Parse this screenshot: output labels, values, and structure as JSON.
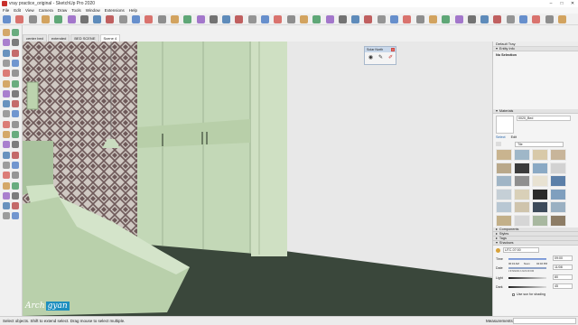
{
  "window": {
    "title": "vray practice_original - SketchUp Pro 2020",
    "controls": [
      "–",
      "□",
      "✕"
    ]
  },
  "menu": [
    "File",
    "Edit",
    "View",
    "Camera",
    "Draw",
    "Tools",
    "Window",
    "Extensions",
    "Help"
  ],
  "toolbar": {
    "icons": [
      "select-icon",
      "paint-icon",
      "eraser-icon",
      "line-icon",
      "move-icon",
      "rotate-icon",
      "pushpull-icon",
      "offset-icon",
      "tape-icon",
      "text-icon",
      "orbit-icon",
      "pan-icon",
      "zoom-icon",
      "zoom-extents-icon",
      "warehouse-icon",
      "extension-icon",
      "layout-icon",
      "iso-icon",
      "top-icon",
      "front-icon",
      "right-icon",
      "back-icon",
      "left-icon",
      "bottom-icon",
      "xray-icon",
      "wireframe-icon",
      "hidden-line-icon",
      "shaded-icon",
      "textured-icon",
      "monochrome-icon",
      "section-icon",
      "shadow-icon",
      "fog-icon",
      "vray-render-icon",
      "vray-asset-icon",
      "vray-light-icon",
      "vray-sphere-icon",
      "vray-mesh-icon",
      "vray-fur-icon",
      "vray-plane-icon",
      "vray-proxy-icon",
      "vray-clipper-icon",
      "vray-frame-icon",
      "vray-ipr-icon"
    ]
  },
  "scenes": {
    "tabs": [
      "center bed",
      "extended",
      "BED SCENE",
      "Scene 4"
    ],
    "active_index": 3
  },
  "viewport": {
    "logo_left": "Arch",
    "logo_right": "gyan"
  },
  "solar_north": {
    "title": "Solar North",
    "close": "x"
  },
  "tray": {
    "title": "Default Tray",
    "entity_info": {
      "header": "Entity Info",
      "selection": "No Selection"
    },
    "materials": {
      "header": "Materials",
      "material_name": "0020_Bed",
      "tabs": [
        "Select",
        "Edit"
      ],
      "library": "Tile"
    },
    "sections": [
      "Components",
      "Styles",
      "Tags"
    ],
    "shadows": {
      "header": "Shadows",
      "utc": "UTC-07:00",
      "time_label": "Time",
      "time_start": "06:43 AM",
      "time_noon": "Noon",
      "time_end": "04:46 PM",
      "time_value": "09:00",
      "date_label": "Date",
      "date_months": "J F M A M J J A S O N D",
      "date_value": "11/08",
      "light_label": "Light",
      "light_value": "80",
      "dark_label": "Dark",
      "dark_value": "45",
      "use_sun": "Use sun for shading"
    }
  },
  "status": {
    "message": "Select objects. Shift to extend select. Drag mouse to select multiple.",
    "measurements_label": "Measurements"
  },
  "colors": {
    "wall_right": "#eaeaea",
    "room_green": "#c6d9b9",
    "floor": "#39473a",
    "wallpaper_dark": "#6f5a5a",
    "accent_blue": "#1d8fbf"
  }
}
